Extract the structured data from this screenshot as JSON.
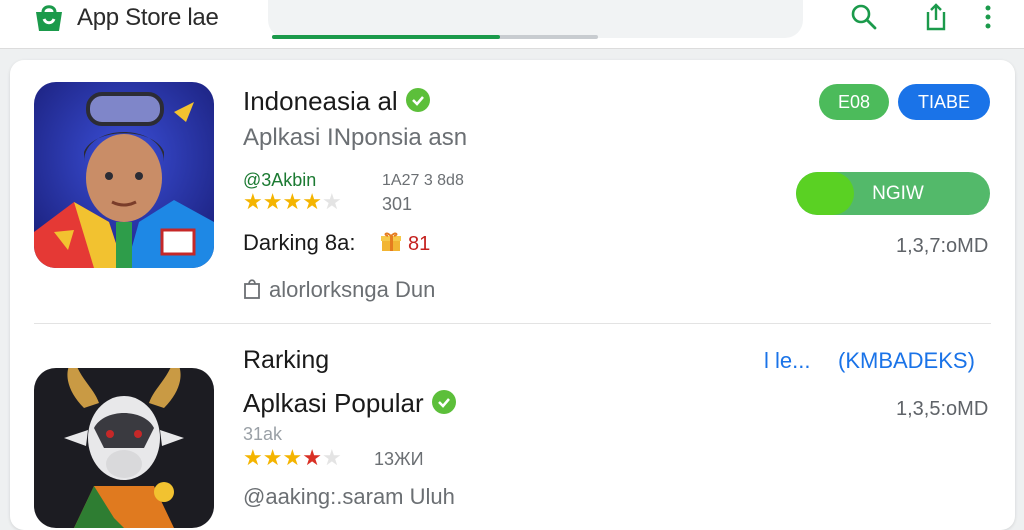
{
  "header": {
    "title": "App Store lae",
    "logo_icon": "store-bag-icon",
    "search_progress": 0.7,
    "icons": [
      "search-icon",
      "share-icon",
      "more-vert-icon"
    ]
  },
  "app1": {
    "title": "Indoneasia al",
    "subtitle": "Aplkasi INponsia asn",
    "developer": "@3Akbin",
    "meta_top": "1A27 3 8d8",
    "meta_bottom": "301",
    "rating": 4,
    "rating_max": 5,
    "ranking_label": "Darking 8a:",
    "ranking_value": "81",
    "footer_text": "alorlorksnga Dun",
    "chip_green": "E08",
    "chip_blue": "TIABE",
    "install_label": "NGIW",
    "install_progress": 0.3,
    "size": "1,3,7:oMD"
  },
  "app2": {
    "section_label": "Rarking",
    "more_link": "l le...",
    "tag_link": "(KMBADEKS)",
    "title": "Aplkasi Popular",
    "badge_text": "31ak",
    "rating": 3,
    "rating_red": 1,
    "rating_max": 5,
    "rating_count": "13ЖИ",
    "size": "1,3,5:oMD",
    "developer": "@aaking:.saram Uluh"
  },
  "colors": {
    "brand_green": "#1b9a4b",
    "install_green": "#5ad123",
    "chip_green": "#4cbb5b",
    "chip_blue": "#1a73e8",
    "star_yellow": "#f4b400",
    "star_red": "#d93025"
  }
}
